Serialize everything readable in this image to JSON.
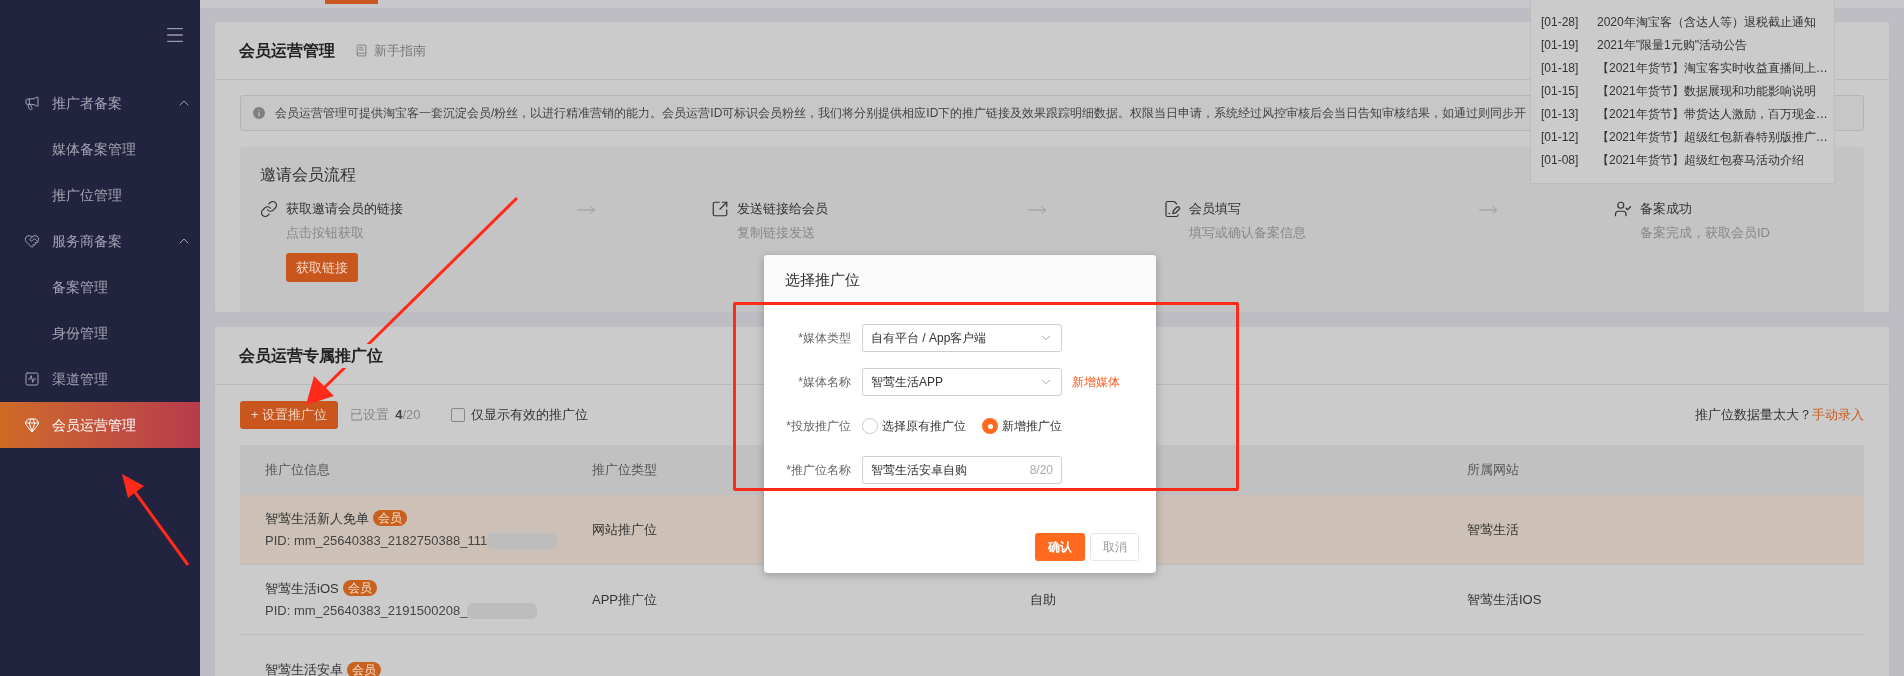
{
  "sidebar": {
    "items": [
      {
        "label": "推广者备案",
        "expanded": true,
        "selected": false,
        "children": [
          {
            "label": "媒体备案管理",
            "selected": false
          },
          {
            "label": "推广位管理",
            "selected": false
          }
        ]
      },
      {
        "label": "服务商备案",
        "expanded": true,
        "selected": false,
        "children": [
          {
            "label": "备案管理",
            "selected": false
          },
          {
            "label": "身份管理",
            "selected": false
          }
        ]
      },
      {
        "label": "渠道管理",
        "selected": false
      },
      {
        "label": "会员运营管理",
        "selected": true
      }
    ]
  },
  "page_card": {
    "title": "会员运营管理",
    "guide_link": "新手指南",
    "notice": "会员运营管理可提供淘宝客一套沉淀会员/粉丝，以进行精准营销的能力。会员运营ID可标识会员粉丝，我们将分别提供相应ID下的推广链接及效果跟踪明细数据。权限当日申请，系统经过风控审核后会当日告知审核结果，如通过则同步开",
    "process": {
      "title": "邀请会员流程",
      "steps": [
        {
          "title": "获取邀请会员的链接",
          "subtitle": "点击按钮获取",
          "button": "获取链接"
        },
        {
          "title": "发送链接给会员",
          "subtitle": "复制链接发送"
        },
        {
          "title": "会员填写",
          "subtitle": "填写或确认备案信息"
        },
        {
          "title": "备案成功",
          "subtitle": "备案完成，获取会员ID"
        }
      ]
    }
  },
  "news": [
    {
      "date": "[01-28]",
      "title": "2020年淘宝客（含达人等）退税截止通知"
    },
    {
      "date": "[01-19]",
      "title": "2021年\"限量1元购\"活动公告"
    },
    {
      "date": "[01-18]",
      "title": "【2021年货节】淘宝客实时收益直播间上…"
    },
    {
      "date": "[01-15]",
      "title": "【2021年货节】数据展现和功能影响说明"
    },
    {
      "date": "[01-13]",
      "title": "【2021年货节】带货达人激励，百万现金…"
    },
    {
      "date": "[01-12]",
      "title": "【2021年货节】超级红包新春特别版推广…"
    },
    {
      "date": "[01-08]",
      "title": "【2021年货节】超级红包赛马活动介绍"
    }
  ],
  "members_card": {
    "title": "会员运营专属推广位",
    "add_button": "+ 设置推广位",
    "count_label": "已设置",
    "count": "**4**/20",
    "only_valid": {
      "label": "仅显示有效的推广位",
      "checked": false
    },
    "hint": "推广位数据量太大？",
    "hint_link": "手动录入",
    "table": {
      "columns": {
        "info": "推广位信息",
        "type": "推广位类型",
        "site": "所属网站"
      },
      "rows": [
        {
          "name": "智莺生活新人免单",
          "badge": "会员",
          "pid": "PID: mm_25640383_2182750388_111",
          "type": "网站推广位",
          "site": "智莺生活",
          "highlighted": true
        },
        {
          "name": "智莺生活iOS",
          "badge": "会员",
          "pid": "PID: mm_25640383_2191500208_",
          "type": "APP推广位",
          "column_3": "自助",
          "site": "智莺生活IOS",
          "highlighted": false
        },
        {
          "name": "智莺生活安卓",
          "badge": "会员",
          "highlighted": false
        }
      ]
    }
  },
  "modal": {
    "title": "选择推广位",
    "fields": [
      {
        "kind": "select",
        "label": "*媒体类型",
        "value": "自有平台 / App客户端"
      },
      {
        "kind": "select",
        "label": "*媒体名称",
        "value": "智莺生活APP",
        "link": "新增媒体"
      },
      {
        "kind": "radio",
        "label": "*投放推广位",
        "options": [
          {
            "label": "选择原有推广位",
            "selected": false
          },
          {
            "label": "新增推广位",
            "selected": true
          }
        ]
      },
      {
        "kind": "text",
        "label": "*推广位名称",
        "value": "智莺生活安卓自购",
        "counter": "8/20"
      }
    ],
    "buttons": [
      {
        "label": "确认",
        "kind": "primary"
      },
      {
        "label": "取消",
        "kind": "secondary"
      }
    ]
  }
}
